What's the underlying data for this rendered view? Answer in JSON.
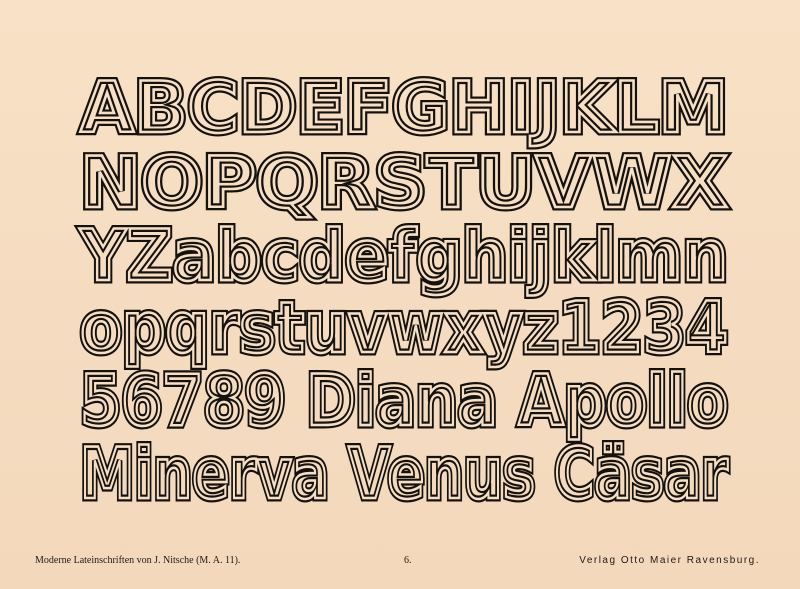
{
  "specimen": {
    "lines": [
      "ABCDEFGHIJKLM",
      "NOPQRSTUVWX",
      "YZabcdefghijklmn",
      "opqrstuvwxyz1234",
      "56789 Diana Apollo",
      "Minerva Venus Cäsar"
    ]
  },
  "footer": {
    "left": "Moderne Lateinschriften von J. Nitsche (M. A. 11).",
    "page_number": "6.",
    "publisher": "Verlag Otto Maier Ravensburg."
  },
  "colors": {
    "paper": "#f6dfc4",
    "ink": "#15120e"
  }
}
